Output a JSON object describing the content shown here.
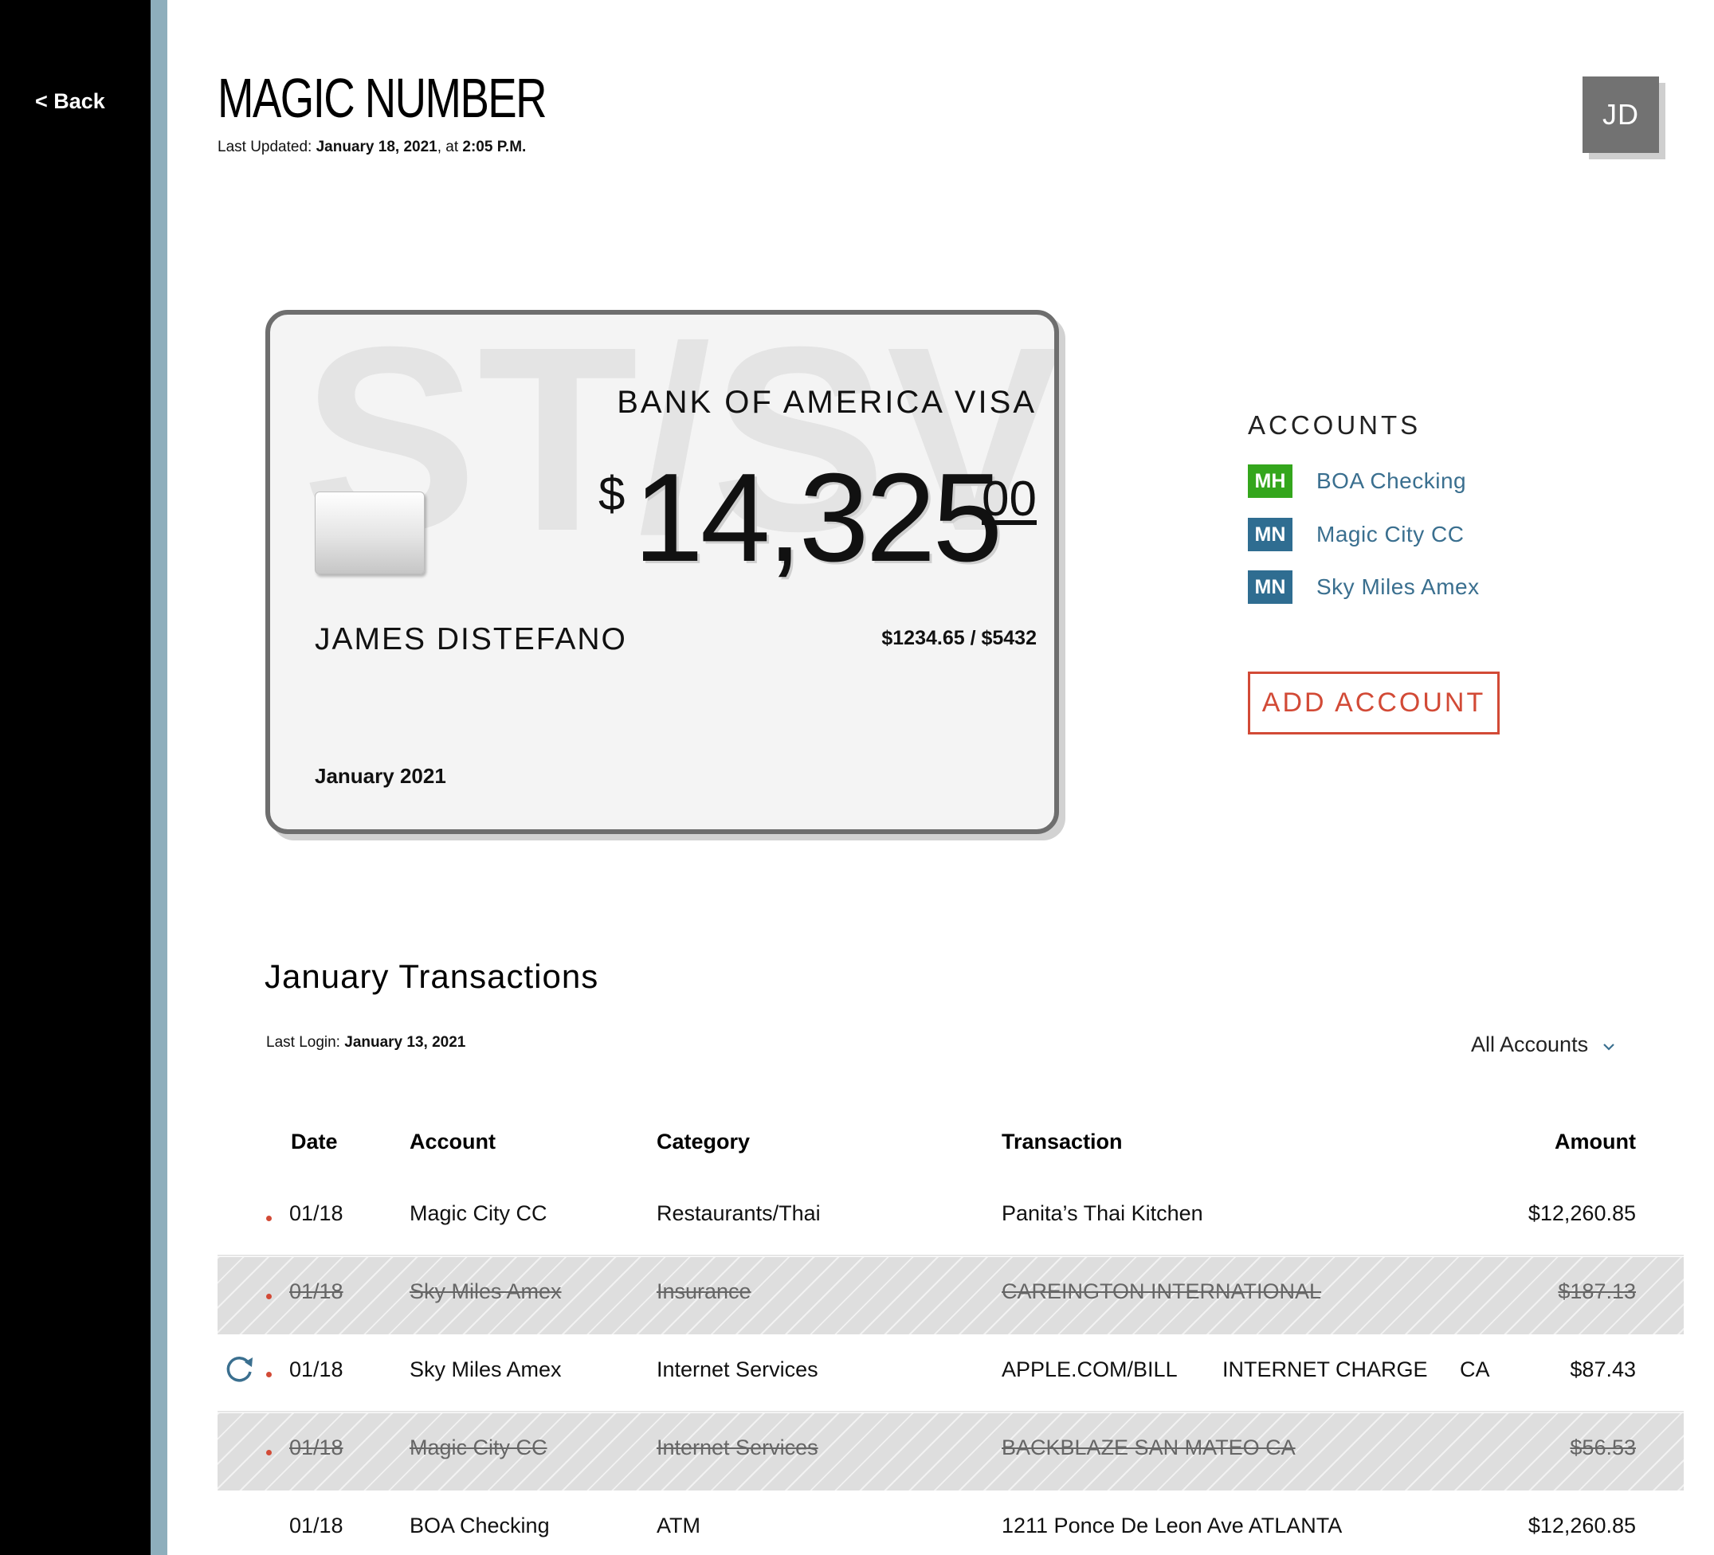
{
  "nav": {
    "back_label": "< Back"
  },
  "header": {
    "title": "MAGIC NUMBER",
    "updated_prefix": "Last Updated: ",
    "updated_date": "January 18, 2021",
    "updated_mid": ", at ",
    "updated_time": "2:05 P.M.",
    "avatar_initials": "JD"
  },
  "card": {
    "bank": "BANK OF AMERICA VISA",
    "currency": "$",
    "amount": "14,325",
    "cents": "00",
    "holder": "JAMES DISTEFANO",
    "limit": "$1234.65  /  $5432",
    "date": "January 2021",
    "watermark": "ST/SVE/LT"
  },
  "accounts": {
    "title": "ACCOUNTS",
    "items": [
      {
        "badge": "MH",
        "name": "BOA Checking",
        "color": "#34a61c"
      },
      {
        "badge": "MN",
        "name": "Magic City CC",
        "color": "#2f6d91"
      },
      {
        "badge": "MN",
        "name": "Sky Miles Amex",
        "color": "#2f6d91"
      }
    ],
    "add_label": "ADD ACCOUNT"
  },
  "transactions": {
    "title": "January Transactions",
    "login_prefix": "Last Login: ",
    "login_date": "January 13, 2021",
    "filter_label": "All Accounts",
    "columns": [
      "Date",
      "Account",
      "Category",
      "Transaction",
      "Amount"
    ],
    "rows": [
      {
        "date": "01/18",
        "account": "Magic City CC",
        "category": "Restaurants/Thai",
        "transaction": "Panita’s Thai Kitchen",
        "amount": "$12,260.85",
        "voided": false,
        "dot": true,
        "recurring": false
      },
      {
        "date": "01/18",
        "account": "Sky Miles Amex",
        "category": "Insurance",
        "transaction": "CAREINGTON INTERNATIONAL",
        "amount": "$187.13",
        "voided": true,
        "dot": true,
        "recurring": false
      },
      {
        "date": "01/18",
        "account": "Sky Miles Amex",
        "category": "Internet Services",
        "transaction": "APPLE.COM/BILL",
        "transaction_extra": "INTERNET CHARGE",
        "transaction_state": "CA",
        "amount": "$87.43",
        "voided": false,
        "dot": true,
        "recurring": true
      },
      {
        "date": "01/18",
        "account": "Magic City CC",
        "category": "Internet Services",
        "transaction": "BACKBLAZE  SAN MATEO  CA",
        "amount": "$56.53",
        "voided": true,
        "dot": true,
        "recurring": false
      },
      {
        "date": "01/18",
        "account": "BOA Checking",
        "category": "ATM",
        "transaction": "1211 Ponce De Leon Ave ATLANTA",
        "amount": "$12,260.85",
        "voided": false,
        "dot": false,
        "recurring": false
      }
    ]
  },
  "colors": {
    "sidebar": "#000000",
    "stripe": "#8eaebc",
    "accent_red": "#d24a36",
    "link_blue": "#3a6f8f"
  }
}
